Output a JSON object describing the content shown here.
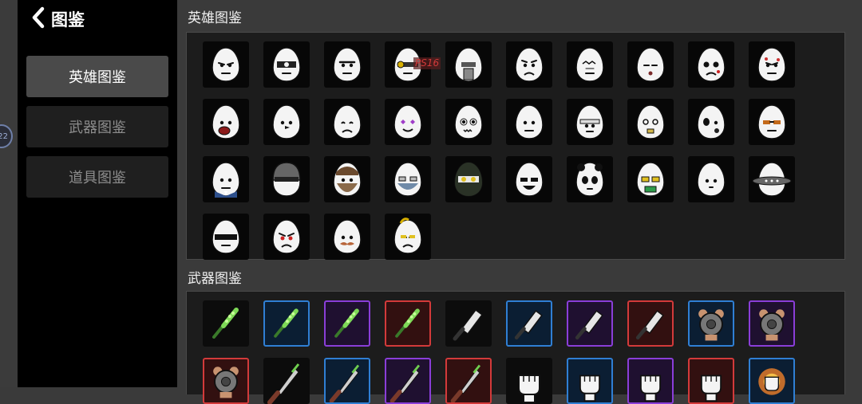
{
  "sidebar": {
    "back_label": "图鉴",
    "items": [
      {
        "label": "英雄图鉴",
        "active": true
      },
      {
        "label": "武器图鉴",
        "active": false
      },
      {
        "label": "道具图鉴",
        "active": false
      }
    ],
    "badge_text": "22"
  },
  "heroes": {
    "title": "英雄图鉴",
    "overlay_text": "PS16",
    "items": [
      "stern",
      "cyclops",
      "unibrow",
      "goggles-gun",
      "robot",
      "worried",
      "scribbled",
      "sleepy",
      "scarred",
      "spotted",
      "screaming",
      "bird",
      "sad",
      "heart-eyes",
      "zombie",
      "plain",
      "bandaged",
      "dizzy",
      "bruised",
      "sunglasses",
      "suit",
      "helmet",
      "bearded",
      "masked",
      "ninja",
      "grinning",
      "panda",
      "gold-glasses",
      "bird-small",
      "ufo",
      "visor",
      "angry",
      "mustache",
      "banana"
    ]
  },
  "weapons": {
    "title": "武器图鉴",
    "items": [
      {
        "icon": "spiked-club-icon",
        "rarity": "normal"
      },
      {
        "icon": "spiked-club-icon",
        "rarity": "blue"
      },
      {
        "icon": "spiked-club-icon",
        "rarity": "purple"
      },
      {
        "icon": "spiked-club-icon",
        "rarity": "red"
      },
      {
        "icon": "cleaver-icon",
        "rarity": "normal"
      },
      {
        "icon": "cleaver-icon",
        "rarity": "blue"
      },
      {
        "icon": "cleaver-icon",
        "rarity": "purple"
      },
      {
        "icon": "cleaver-icon",
        "rarity": "red"
      },
      {
        "icon": "saw-blade-icon",
        "rarity": "blue"
      },
      {
        "icon": "saw-blade-icon",
        "rarity": "purple"
      },
      {
        "icon": "saw-blade-icon",
        "rarity": "red"
      },
      {
        "icon": "machete-icon",
        "rarity": "normal"
      },
      {
        "icon": "machete-icon",
        "rarity": "blue"
      },
      {
        "icon": "machete-icon",
        "rarity": "purple"
      },
      {
        "icon": "machete-icon",
        "rarity": "red"
      },
      {
        "icon": "fist-icon",
        "rarity": "normal"
      },
      {
        "icon": "fist-icon",
        "rarity": "blue"
      },
      {
        "icon": "fist-icon",
        "rarity": "purple"
      },
      {
        "icon": "fist-icon",
        "rarity": "red"
      },
      {
        "icon": "fire-fist-icon",
        "rarity": "blue"
      }
    ]
  },
  "colors": {
    "blue": "#2f7fd4",
    "purple": "#8a3ed8",
    "red": "#d33a3a"
  }
}
